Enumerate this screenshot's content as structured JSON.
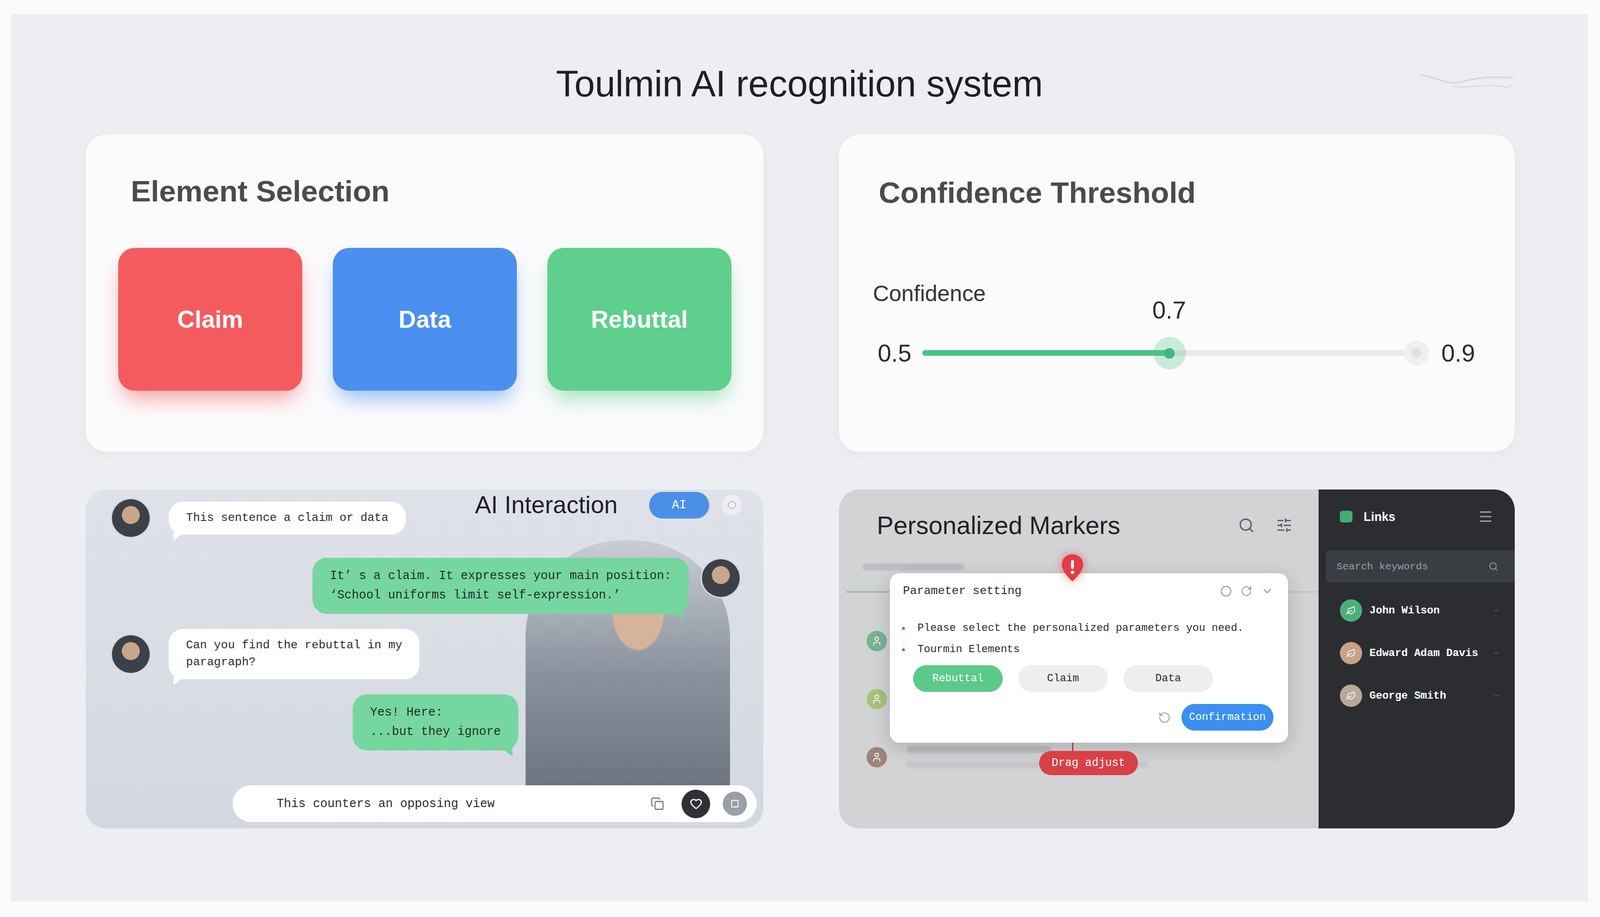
{
  "window": {
    "title": "Toulmin AI recognition system"
  },
  "element_selection": {
    "title": "Element Selection",
    "elements": [
      {
        "label": "Claim",
        "color": "#f45b5f"
      },
      {
        "label": "Data",
        "color": "#4b8ff0"
      },
      {
        "label": "Rebuttal",
        "color": "#5fcf8e"
      }
    ]
  },
  "confidence": {
    "title": "Confidence Threshold",
    "label": "Confidence",
    "min": "0.5",
    "max": "0.9",
    "value": "0.7",
    "level": 0.5
  },
  "ai_interaction": {
    "title": "AI Interaction",
    "badge": "AI",
    "messages": [
      {
        "kind": "user",
        "avatar": true,
        "lines": [
          "This sentence a claim or data"
        ]
      },
      {
        "kind": "ai",
        "avatar": true,
        "lines": [
          "It’ s a claim. It expresses your main position:",
          "‘School uniforms limit self-expression.’"
        ]
      },
      {
        "kind": "user",
        "avatar": true,
        "lines": [
          "Can you find the rebuttal in my",
          "paragraph?"
        ]
      },
      {
        "kind": "ai",
        "avatar": false,
        "lines": [
          "Yes! Here:",
          "...but they ignore"
        ]
      }
    ],
    "input": {
      "value": "This counters an opposing view"
    }
  },
  "personalized_markers": {
    "title": "Personalized Markers",
    "rows": [
      {
        "color": "#5aa97a"
      },
      {
        "color": "#9bbf5a"
      },
      {
        "color": "#8a6a5a"
      }
    ],
    "dialog": {
      "title": "Parameter setting",
      "prompt": "Please select the personalized parameters you need.",
      "group": "Tourmin Elements",
      "options": [
        {
          "label": "Rebuttal",
          "selected": true
        },
        {
          "label": "Claim",
          "selected": false
        },
        {
          "label": "Data",
          "selected": false
        }
      ],
      "confirm": "Confirmation"
    },
    "drag_label": "Drag adjust"
  },
  "sidebar": {
    "title": "Links",
    "search": {
      "placeholder": "Search keywords"
    },
    "contacts": [
      {
        "name": "John Wilson",
        "color": "#4caf7a"
      },
      {
        "name": "Edward Adam Davis",
        "color": "#c9a088"
      },
      {
        "name": "George Smith",
        "color": "#b9a89a"
      }
    ]
  }
}
